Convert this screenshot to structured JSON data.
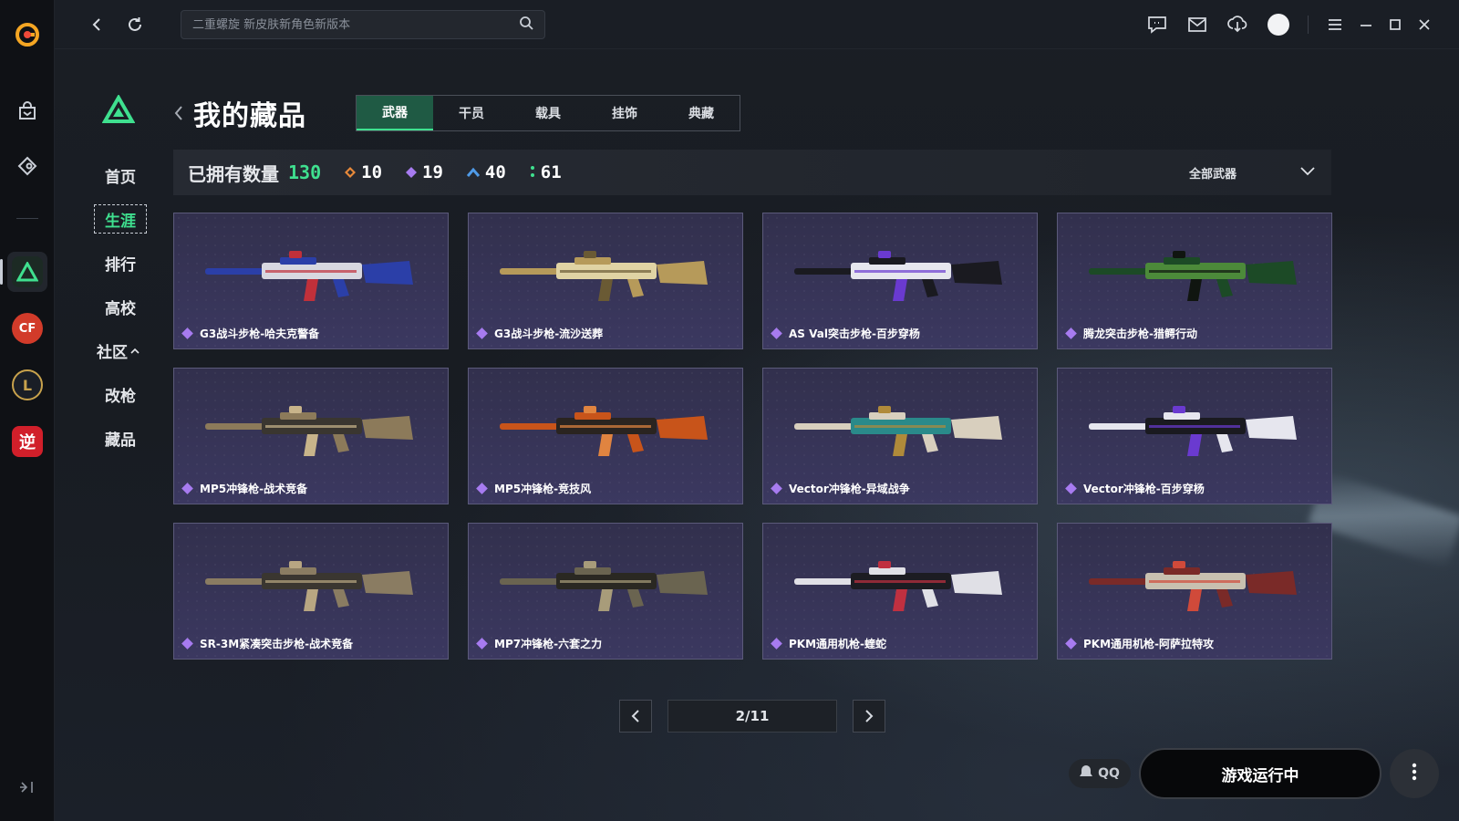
{
  "search": {
    "placeholder": "二重螺旋 新皮肤新角色新版本"
  },
  "sidebar": {
    "items": [
      {
        "label": "首页",
        "active": false
      },
      {
        "label": "生涯",
        "active": true
      },
      {
        "label": "排行",
        "active": false
      },
      {
        "label": "高校",
        "active": false
      },
      {
        "label": "社区",
        "active": false
      },
      {
        "label": "改枪",
        "active": false
      },
      {
        "label": "藏品",
        "active": false
      }
    ],
    "rail_games": [
      {
        "icon": "delta-force-icon",
        "color": "#3fe08f"
      },
      {
        "icon": "crossfire-icon",
        "color": "#d23b2a"
      },
      {
        "icon": "league-of-legends-icon",
        "color": "#c8a24c"
      },
      {
        "icon": "ni-shui-han-icon",
        "label": "逆",
        "color": "#d11f2a"
      }
    ]
  },
  "header": {
    "title": "我的藏品",
    "tabs": [
      {
        "label": "武器",
        "active": true
      },
      {
        "label": "干员",
        "active": false
      },
      {
        "label": "载具",
        "active": false
      },
      {
        "label": "挂饰",
        "active": false
      },
      {
        "label": "典藏",
        "active": false
      }
    ]
  },
  "stats": {
    "label": "已拥有数量",
    "total": "130",
    "rarities": [
      {
        "icon": "orange-diamond-icon",
        "color": "#e8893a",
        "count": "10"
      },
      {
        "icon": "purple-diamond-icon",
        "color": "#a77bf0",
        "count": "19"
      },
      {
        "icon": "blue-chevron-icon",
        "color": "#4f9be8",
        "count": "40"
      },
      {
        "icon": "green-dots-icon",
        "color": "#3fe08f",
        "count": "61"
      }
    ],
    "filter": "全部武器"
  },
  "items": [
    {
      "name": "G3战斗步枪-哈夫克警备",
      "palette": [
        "#2b3fa8",
        "#d8d8e0",
        "#c0303a"
      ]
    },
    {
      "name": "G3战斗步枪-流沙送葬",
      "palette": [
        "#b69a5a",
        "#e0d3a4",
        "#6a5a34"
      ]
    },
    {
      "name": "AS Val突击步枪-百步穿杨",
      "palette": [
        "#1a1a20",
        "#e6e6ee",
        "#6a3ad0"
      ]
    },
    {
      "name": "腾龙突击步枪-猎鳄行动",
      "palette": [
        "#1c4a26",
        "#4c8a3a",
        "#101510"
      ]
    },
    {
      "name": "MP5冲锋枪-战术竞备",
      "palette": [
        "#8c7a5a",
        "#3a3630",
        "#c8b48a"
      ]
    },
    {
      "name": "MP5冲锋枪-竞技风",
      "palette": [
        "#c8541a",
        "#2a2420",
        "#e08440"
      ]
    },
    {
      "name": "Vector冲锋枪-异域战争",
      "palette": [
        "#d8cfbe",
        "#2a8a8a",
        "#b08a3a"
      ]
    },
    {
      "name": "Vector冲锋枪-百步穿杨",
      "palette": [
        "#e6e6ee",
        "#1a1a20",
        "#6a3ad0"
      ]
    },
    {
      "name": "SR-3M紧凑突击步枪-战术竞备",
      "palette": [
        "#8a7c62",
        "#3a3630",
        "#b8a682"
      ]
    },
    {
      "name": "MP7冲锋枪-六套之力",
      "palette": [
        "#6a6450",
        "#2a2822",
        "#a89c7a"
      ]
    },
    {
      "name": "PKM通用机枪-蝰蛇",
      "palette": [
        "#e0e0e6",
        "#1c1c22",
        "#c03040"
      ]
    },
    {
      "name": "PKM通用机枪-阿萨拉特攻",
      "palette": [
        "#7a2a28",
        "#c8c0b0",
        "#d04a3a"
      ]
    }
  ],
  "pager": {
    "text": "2/11"
  },
  "bottom": {
    "qq_label": "QQ",
    "run_label": "游戏运行中"
  }
}
